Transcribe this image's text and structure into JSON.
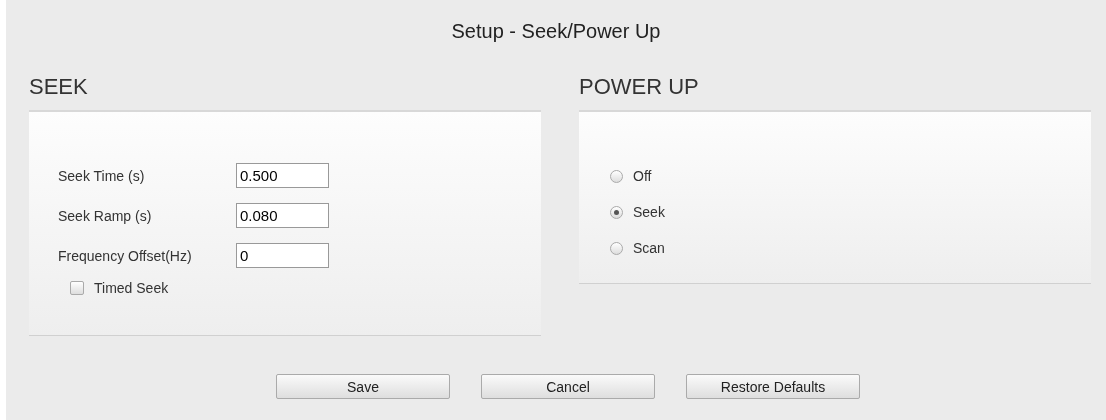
{
  "title": "Setup - Seek/Power Up",
  "seek": {
    "heading": "SEEK",
    "fields": [
      {
        "label": "Seek Time (s)",
        "value": "0.500"
      },
      {
        "label": "Seek Ramp (s)",
        "value": "0.080"
      },
      {
        "label": "Frequency Offset(Hz)",
        "value": "0"
      }
    ],
    "timed_seek": {
      "label": "Timed Seek",
      "checked": false
    }
  },
  "power_up": {
    "heading": "POWER UP",
    "options": [
      {
        "label": "Off",
        "selected": false
      },
      {
        "label": "Seek",
        "selected": true
      },
      {
        "label": "Scan",
        "selected": false
      }
    ]
  },
  "buttons": [
    "Save",
    "Cancel",
    "Restore Defaults"
  ]
}
